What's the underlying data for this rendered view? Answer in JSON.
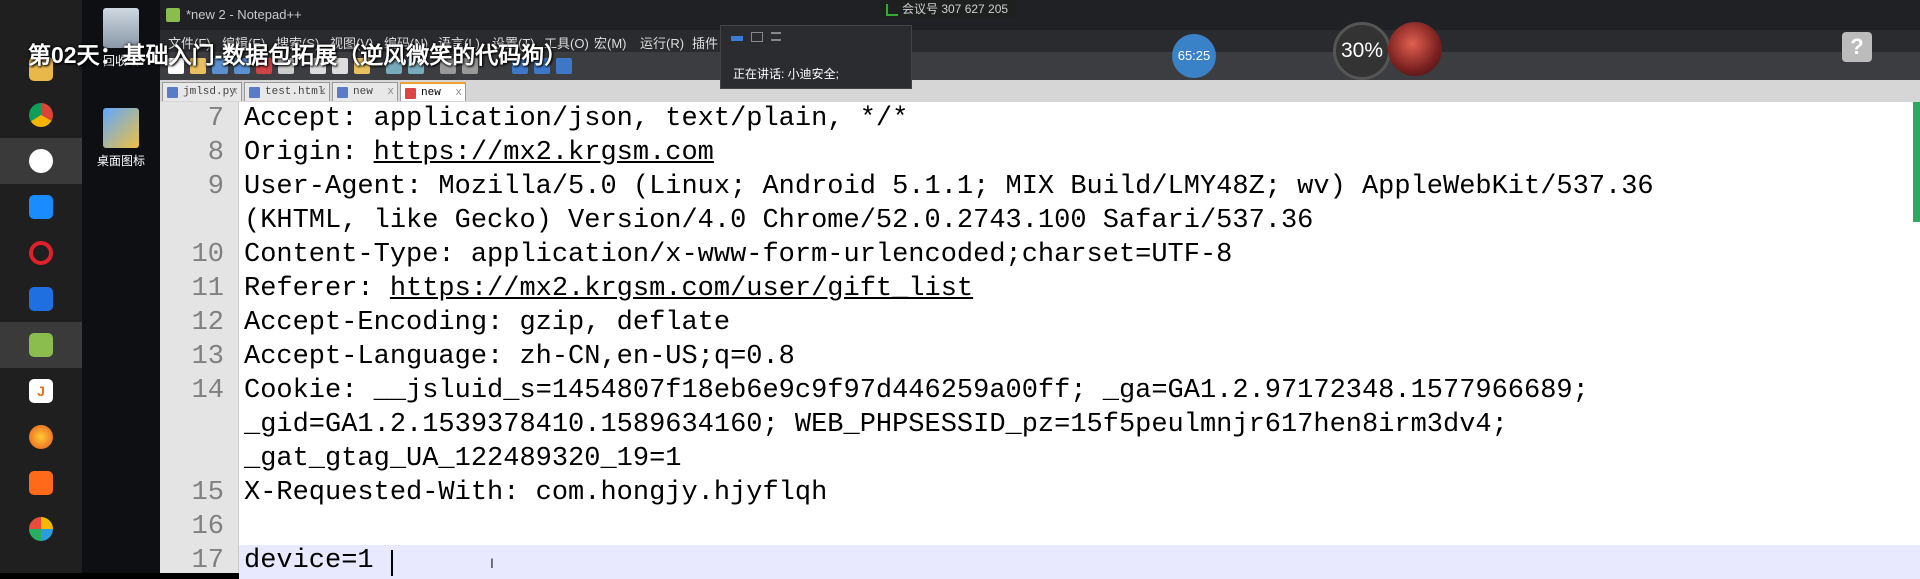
{
  "window": {
    "title": "*new 2 - Notepad++"
  },
  "video_title": "第02天：基础入门-数据包拓展（逆风微笑的代码狗）",
  "meeting": {
    "id_text": "会议号 307 627 205"
  },
  "speaker": {
    "label": "正在讲话: 小迪安全;"
  },
  "timer": "65:25",
  "cpu_gauge": "30%",
  "menu": [
    "文件(F)",
    "编辑(E)",
    "搜索(S)",
    "视图(V)",
    "编码(N)",
    "语言(L)",
    "设置(T)",
    "工具(O)",
    "宏(M)",
    "运行(R)",
    "插件"
  ],
  "tabs": [
    {
      "label": "jmlsd.py"
    },
    {
      "label": "test.html"
    },
    {
      "label": "new 1"
    },
    {
      "label": "new 2"
    }
  ],
  "desktop_icons": [
    {
      "label": "回收站"
    },
    {
      "label": "桌面图标"
    }
  ],
  "editor": {
    "current_line": 17,
    "lines": [
      {
        "num": "7",
        "segments": [
          {
            "t": "Accept: application/json, text/plain, */*"
          }
        ]
      },
      {
        "num": "8",
        "segments": [
          {
            "t": "Origin: "
          },
          {
            "t": "https://mx2.krgsm.com",
            "link": true
          }
        ]
      },
      {
        "num": "9",
        "segments": [
          {
            "t": "User-Agent: Mozilla/5.0 (Linux; Android 5.1.1; MIX Build/LMY48Z; wv) AppleWebKit/537.36"
          }
        ]
      },
      {
        "num": "",
        "segments": [
          {
            "t": "(KHTML, like Gecko) Version/4.0 Chrome/52.0.2743.100 Safari/537.36"
          }
        ]
      },
      {
        "num": "10",
        "segments": [
          {
            "t": "Content-Type: application/x-www-form-urlencoded;charset=UTF-8"
          }
        ]
      },
      {
        "num": "11",
        "segments": [
          {
            "t": "Referer: "
          },
          {
            "t": "https://mx2.krgsm.com/user/gift_list",
            "link": true
          }
        ]
      },
      {
        "num": "12",
        "segments": [
          {
            "t": "Accept-Encoding: gzip, deflate"
          }
        ]
      },
      {
        "num": "13",
        "segments": [
          {
            "t": "Accept-Language: zh-CN,en-US;q=0.8"
          }
        ]
      },
      {
        "num": "14",
        "segments": [
          {
            "t": "Cookie: __jsluid_s=1454807f18eb6e9c9f97d446259a00ff; _ga=GA1.2.97172348.1577966689;"
          }
        ]
      },
      {
        "num": "",
        "segments": [
          {
            "t": "_gid=GA1.2.1539378410.1589634160; WEB_PHPSESSID_pz=15f5peulmnjr617hen8irm3dv4;"
          }
        ]
      },
      {
        "num": "",
        "segments": [
          {
            "t": "_gat_gtag_UA_122489320_19=1"
          }
        ]
      },
      {
        "num": "15",
        "segments": [
          {
            "t": "X-Requested-With: com.hongjy.hjyflqh"
          }
        ]
      },
      {
        "num": "16",
        "segments": [
          {
            "t": ""
          }
        ]
      },
      {
        "num": "17",
        "segments": [
          {
            "t": "device=1"
          }
        ]
      }
    ]
  },
  "colors": {
    "gutter_bg": "#e4e4e4",
    "current_line_bg": "#e8e8ff",
    "timer_badge": "#3a82c8",
    "scroll_indicator": "#2fa860"
  }
}
